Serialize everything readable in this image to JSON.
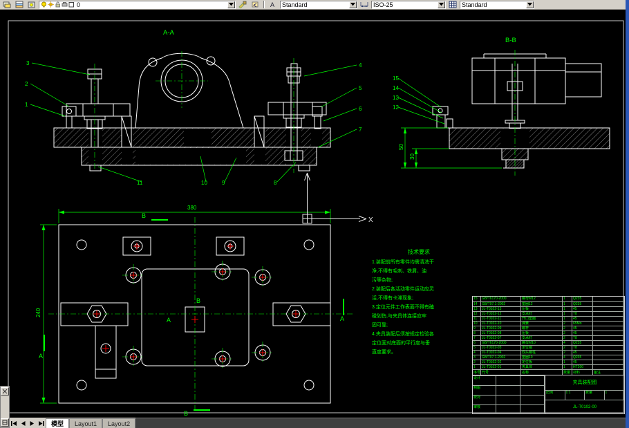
{
  "toolbar": {
    "layer_combo": {
      "value": "0"
    },
    "text_style_combo": {
      "value": "Standard"
    },
    "dim_style_combo": {
      "value": "ISO-25"
    },
    "table_style_combo": {
      "value": "Standard"
    }
  },
  "tabs": {
    "model": "模型",
    "layout1": "Layout1",
    "layout2": "Layout2"
  },
  "drawing": {
    "view_labels": {
      "aa": "A-A",
      "bb": "B-B"
    },
    "dims": {
      "width": "380",
      "height": "240",
      "d50": "50",
      "d30": "30"
    },
    "balloons": [
      "1",
      "2",
      "3",
      "4",
      "5",
      "6",
      "7",
      "8",
      "9",
      "10",
      "11",
      "12",
      "13",
      "14",
      "15"
    ],
    "section_marks": {
      "a": "A",
      "b": "B"
    },
    "axis_x_label": "X",
    "notes": {
      "title": "技术要求",
      "lines": [
        "1.装配前所有零件均需清洗干",
        "  净,不得有毛刺、铁屑、油",
        "  污等杂物;",
        "2.装配后各活动零件运动应灵",
        "  活,不得有卡滞现象;",
        "3.定位元件工作表面不得有磕",
        "  碰划伤,与夹具体连接应牢",
        "  固可靠;",
        "4.夹具装配后须按规定检验各",
        "  定位面对底面的平行度与垂",
        "  直度要求。"
      ]
    }
  },
  "bom": {
    "headers": [
      "序号",
      "代号",
      "名称",
      "数量",
      "材料",
      "备注"
    ],
    "rows": [
      [
        "15",
        "GB/T6170-2000",
        "螺母M12",
        "1",
        "Q235",
        ""
      ],
      [
        "14",
        "GB/T97.1-2002",
        "垫圈12",
        "1",
        "Q235",
        ""
      ],
      [
        "13",
        "JL-T0102-13",
        "压板",
        "1",
        "45",
        ""
      ],
      [
        "12",
        "JL-T0102-12",
        "支承钉",
        "1",
        "T8",
        ""
      ],
      [
        "11",
        "JL-T0102-11",
        "开口垫圈",
        "1",
        "45",
        ""
      ],
      [
        "10",
        "JL-T0102-10",
        "弹簧",
        "2",
        "65Mn",
        ""
      ],
      [
        "9",
        "JL-T0102-09",
        "螺杆",
        "2",
        "45",
        ""
      ],
      [
        "8",
        "JL-T0102-08",
        "压板",
        "2",
        "45",
        ""
      ],
      [
        "7",
        "JL-T0102-07",
        "支承钉",
        "2",
        "T8",
        ""
      ],
      [
        "6",
        "GB/T6170-2000",
        "螺母M10",
        "4",
        "Q235",
        ""
      ],
      [
        "5",
        "JL-T0102-05",
        "定位销",
        "2",
        "T8",
        ""
      ],
      [
        "4",
        "JL-T0102-04",
        "双头螺柱",
        "2",
        "45",
        ""
      ],
      [
        "3",
        "GB/T97.1-2002",
        "垫圈10",
        "4",
        "Q235",
        ""
      ],
      [
        "2",
        "JL-T0102-02",
        "定位板",
        "1",
        "45",
        ""
      ],
      [
        "1",
        "JL-T0102-01",
        "夹具体",
        "1",
        "HT200",
        ""
      ]
    ]
  },
  "titleblock": {
    "roles": [
      "设计",
      "制图",
      "校对",
      "审核"
    ],
    "scale_label": "比例",
    "scale": "1:1",
    "qty_label": "数量",
    "qty": "1",
    "title": "夹具装配图",
    "code": "JL-T0102-00"
  }
}
